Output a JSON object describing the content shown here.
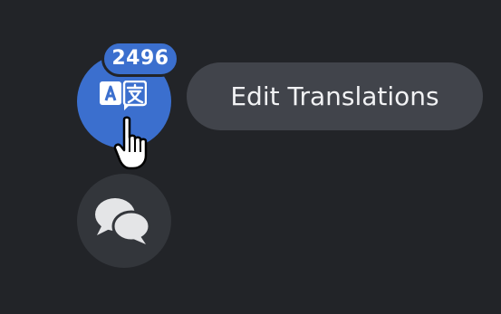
{
  "translate_button": {
    "badge_count": "2496",
    "icon": "translate-icon",
    "color": "#3b6fce"
  },
  "tooltip": {
    "label": "Edit Translations"
  },
  "comments_button": {
    "icon": "comments-icon"
  },
  "cursor": {
    "icon": "hand-pointer-icon"
  },
  "colors": {
    "background": "#222428",
    "tooltip_bg": "#41444b",
    "secondary_button_bg": "#33363b"
  }
}
